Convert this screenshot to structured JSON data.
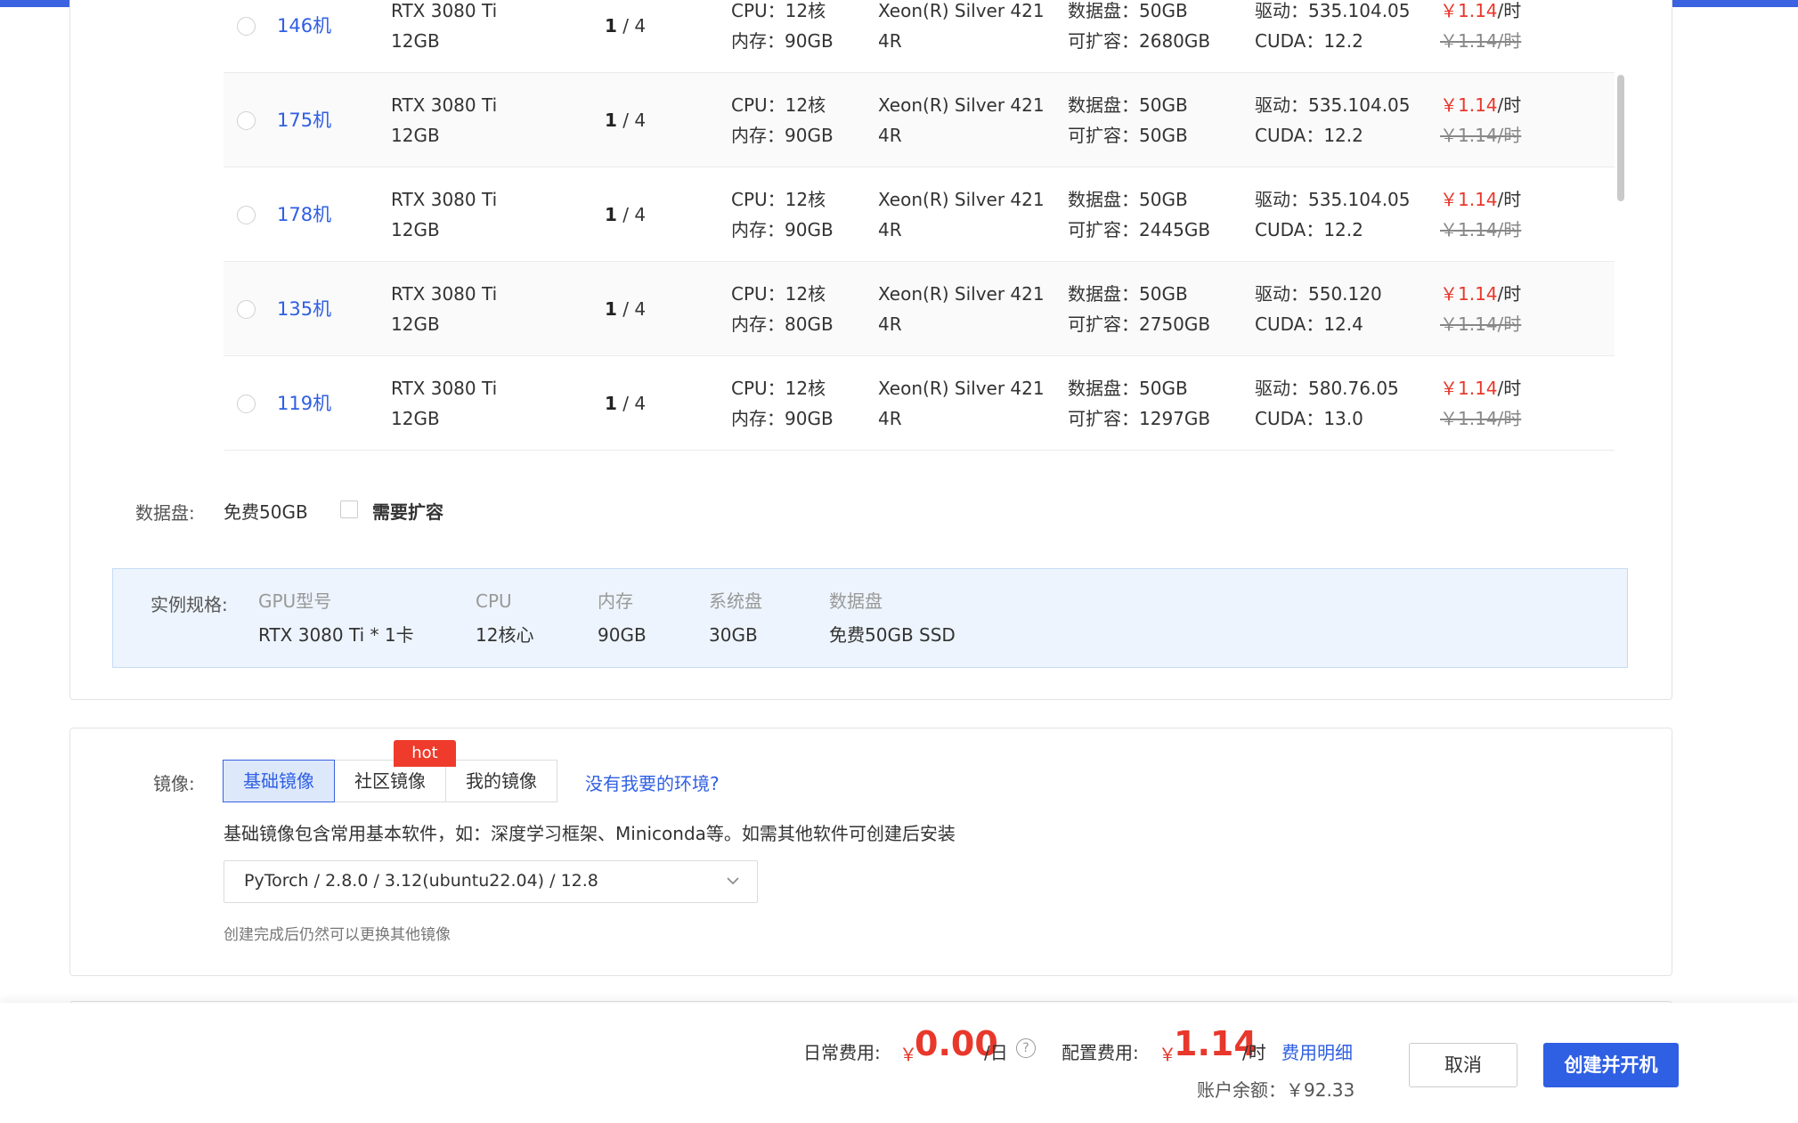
{
  "machines": [
    {
      "name": "146机",
      "gpu_line1": "RTX 3080 Ti",
      "gpu_line2": "12GB",
      "avail_free": "1",
      "avail_total": " / 4",
      "cpu": "CPU：12核",
      "mem": "内存：90GB",
      "xeon_line1": "Xeon(R) Silver 421",
      "xeon_line2": "4R",
      "disk": "数据盘：50GB",
      "expand": "可扩容：2680GB",
      "driver": "驱动：535.104.05",
      "cuda": "CUDA：12.2",
      "price_now": "￥1.14",
      "price_unit": "/时",
      "price_old": "￥1.14/时"
    },
    {
      "name": "175机",
      "gpu_line1": "RTX 3080 Ti",
      "gpu_line2": "12GB",
      "avail_free": "1",
      "avail_total": " / 4",
      "cpu": "CPU：12核",
      "mem": "内存：90GB",
      "xeon_line1": "Xeon(R) Silver 421",
      "xeon_line2": "4R",
      "disk": "数据盘：50GB",
      "expand": "可扩容：50GB",
      "driver": "驱动：535.104.05",
      "cuda": "CUDA：12.2",
      "price_now": "￥1.14",
      "price_unit": "/时",
      "price_old": "￥1.14/时"
    },
    {
      "name": "178机",
      "gpu_line1": "RTX 3080 Ti",
      "gpu_line2": "12GB",
      "avail_free": "1",
      "avail_total": " / 4",
      "cpu": "CPU：12核",
      "mem": "内存：90GB",
      "xeon_line1": "Xeon(R) Silver 421",
      "xeon_line2": "4R",
      "disk": "数据盘：50GB",
      "expand": "可扩容：2445GB",
      "driver": "驱动：535.104.05",
      "cuda": "CUDA：12.2",
      "price_now": "￥1.14",
      "price_unit": "/时",
      "price_old": "￥1.14/时"
    },
    {
      "name": "135机",
      "gpu_line1": "RTX 3080 Ti",
      "gpu_line2": "12GB",
      "avail_free": "1",
      "avail_total": " / 4",
      "cpu": "CPU：12核",
      "mem": "内存：80GB",
      "xeon_line1": "Xeon(R) Silver 421",
      "xeon_line2": "4R",
      "disk": "数据盘：50GB",
      "expand": "可扩容：2750GB",
      "driver": "驱动：550.120",
      "cuda": "CUDA：12.4",
      "price_now": "￥1.14",
      "price_unit": "/时",
      "price_old": "￥1.14/时"
    },
    {
      "name": "119机",
      "gpu_line1": "RTX 3080 Ti",
      "gpu_line2": "12GB",
      "avail_free": "1",
      "avail_total": " / 4",
      "cpu": "CPU：12核",
      "mem": "内存：90GB",
      "xeon_line1": "Xeon(R) Silver 421",
      "xeon_line2": "4R",
      "disk": "数据盘：50GB",
      "expand": "可扩容：1297GB",
      "driver": "驱动：580.76.05",
      "cuda": "CUDA：13.0",
      "price_now": "￥1.14",
      "price_unit": "/时",
      "price_old": "￥1.14/时"
    }
  ],
  "data_disk": {
    "label": "数据盘:",
    "free": "免费50GB",
    "expand_label": "需要扩容",
    "expand_checked": false
  },
  "spec": {
    "label": "实例规格:",
    "columns": [
      {
        "head": "GPU型号",
        "value": "RTX 3080 Ti * 1卡"
      },
      {
        "head": "CPU",
        "value": "12核心"
      },
      {
        "head": "内存",
        "value": "90GB"
      },
      {
        "head": "系统盘",
        "value": "30GB"
      },
      {
        "head": "数据盘",
        "value": "免费50GB SSD"
      }
    ]
  },
  "image": {
    "label": "镜像:",
    "tabs": [
      "基础镜像",
      "社区镜像",
      "我的镜像"
    ],
    "active_tab": 0,
    "hot_badge": "hot",
    "no_env_link": "没有我要的环境?",
    "hint": "基础镜像包含常用基本软件，如：深度学习框架、Miniconda等。如需其他软件可创建后安装",
    "select_value": "PyTorch / 2.8.0 / 3.12(ubuntu22.04) / 12.8",
    "sub_hint": "创建完成后仍然可以更换其他镜像"
  },
  "footer": {
    "daily_label": "日常费用:",
    "daily_currency": "￥",
    "daily_amount": "0.00",
    "daily_unit": "/日",
    "help_icon": "?",
    "config_label": "配置费用:",
    "config_currency": "￥",
    "config_amount": "1.14",
    "config_unit": "/时",
    "fee_detail_link": "费用明细",
    "balance": "账户余额：￥92.33",
    "cancel_label": "取消",
    "create_label": "创建并开机"
  },
  "colors": {
    "accent": "#3b62e0",
    "link": "#2f5fe3",
    "price_red": "#e8382b",
    "hot_badge": "#ee3b2b",
    "spec_bg": "#edf4fd"
  }
}
